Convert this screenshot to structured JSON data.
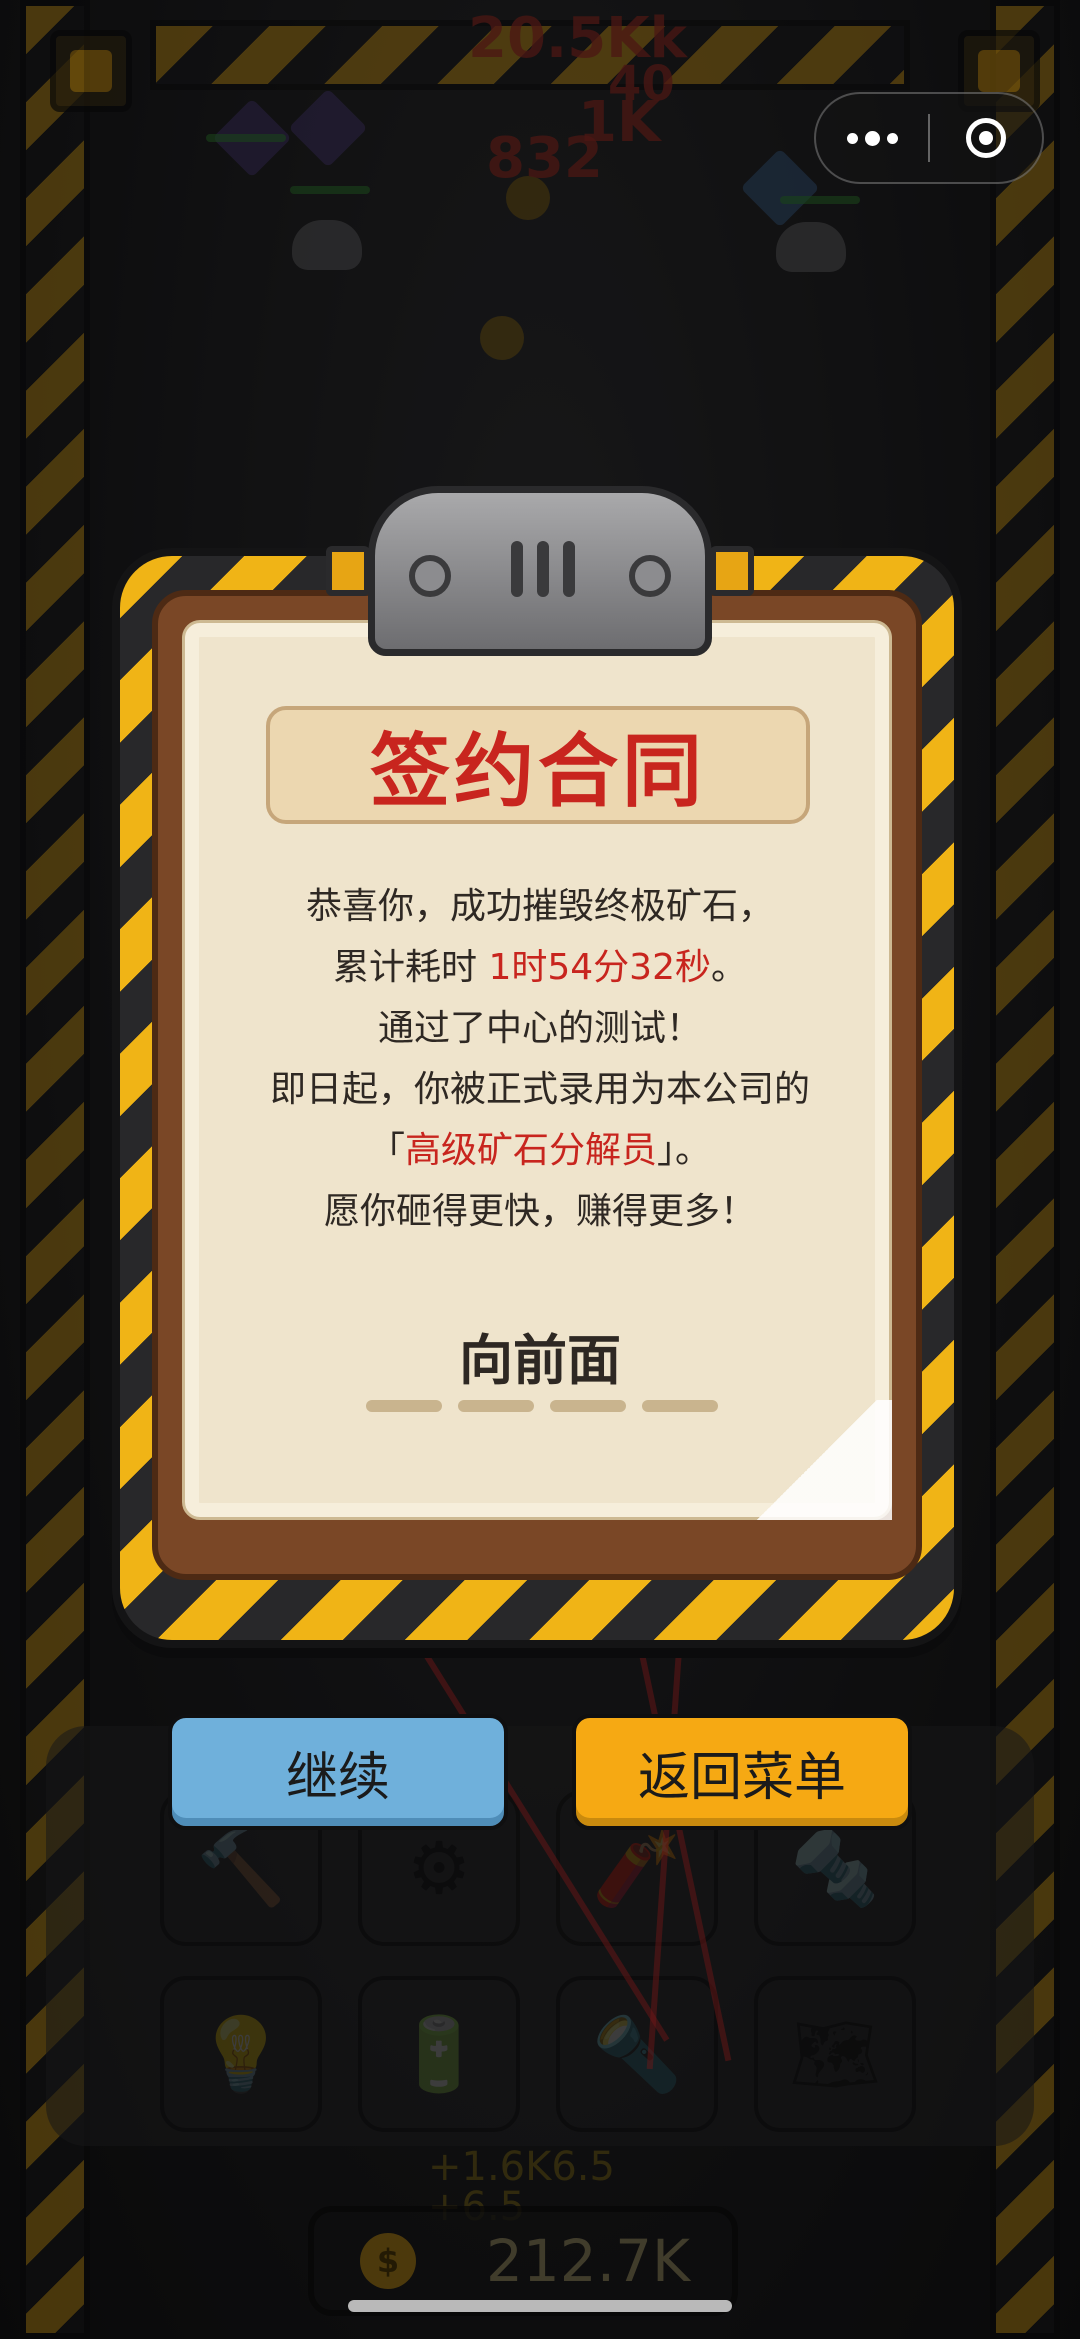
{
  "capsule": {
    "menu_icon": "more-dots-icon",
    "close_icon": "target-circle-icon"
  },
  "background": {
    "floating_numbers": [
      "20.5Kk",
      "40",
      "1K",
      "832"
    ],
    "panel_gain_lines": [
      "+1.6K6.5",
      "+6.5"
    ]
  },
  "dialog": {
    "title": "签约合同",
    "line1": "恭喜你，成功摧毁终极矿石，",
    "line2_prefix": "累计耗时 ",
    "line2_time": "1时54分32秒",
    "line2_suffix": "。",
    "line3": "通过了中心的测试！",
    "line4": "即日起，你被正式录用为本公司的",
    "line5_open": "「",
    "line5_role": "高级矿石分解员",
    "line5_close": "」。",
    "line6": "愿你砸得更快，赚得更多！",
    "forward_label": "向前面"
  },
  "buttons": {
    "continue_label": "继续",
    "menu_label": "返回菜单"
  },
  "inventory": {
    "slots": [
      "hammer-icon",
      "gear-icon",
      "dynamite-icon",
      "drill-icon",
      "lightbulb-icon",
      "battery-icon",
      "laser-cannon-icon",
      "blueprint-icon"
    ]
  },
  "counter": {
    "value": "212.7K",
    "coin_icon": "coin-icon"
  },
  "colors": {
    "accent_red": "#c8251e",
    "continue_blue": "#6fb0db",
    "menu_orange": "#f6a913",
    "hazard_yellow": "#f0b416"
  }
}
